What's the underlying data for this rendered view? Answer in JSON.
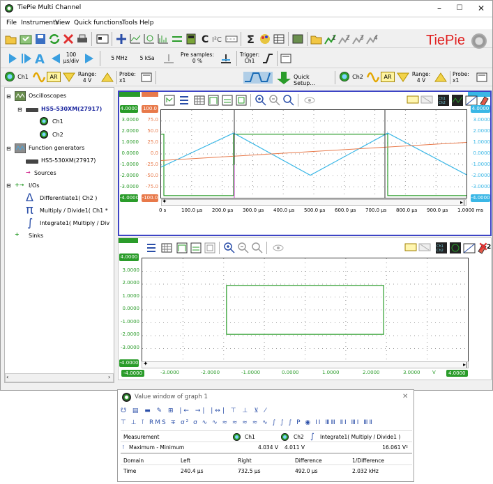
{
  "window": {
    "title": "TiePie Multi Channel",
    "min": "–",
    "max": "☐",
    "close": "✕"
  },
  "menu": [
    "File",
    "Instruments",
    "View",
    "Quick functions",
    "Tools",
    "Help"
  ],
  "brand": "TiePie",
  "toolbar2": {
    "timebase": "100",
    "timebase_unit": "µs/div",
    "samplerate": "5 MHz",
    "record_length": "5 kSa",
    "pre_samples_label": "Pre samples:",
    "pre_samples_value": "0 %",
    "trigger_label": "Trigger:",
    "trigger_value": "Ch1"
  },
  "toolbar3": {
    "ch1": "Ch1",
    "ch2": "Ch2",
    "coupling": "AR",
    "range_label": "Range:",
    "range_value": "4 V",
    "probe_label": "Probe:",
    "probe_value": "x1",
    "quick_setup": "Quick Setup..."
  },
  "tree": {
    "oscilloscopes": "Oscilloscopes",
    "device": "HS5-530XM(27917)",
    "ch1": "Ch1",
    "ch2": "Ch2",
    "function_generators": "Function generators",
    "gen_device": "HS5-530XM(27917)",
    "sources": "Sources",
    "ios": "I/Os",
    "differentiate": "Differentiate1( Ch2 )",
    "multiply": "Multiply / Divide1( Ch1 *",
    "integrate": "Integrate1( Multiply / Div",
    "sinks": "Sinks"
  },
  "graph1": {
    "number": "1",
    "y_left": [
      "3.0000",
      "2.0000",
      "1.0000",
      "0.0000",
      "-1.0000",
      "-2.0000",
      "-3.0000"
    ],
    "y_mid": [
      "75.0",
      "50.0",
      "25.0",
      "0.0",
      "-25.0",
      "-50.0",
      "-75.0"
    ],
    "y_top_left": "4.0000",
    "y_top_mid": "100.0",
    "y_bot_left": "-4.0000",
    "y_bot_mid": "-100.0",
    "y_right": [
      "3.0000",
      "2.0000",
      "1.0000",
      "0.0000",
      "-1.0000",
      "-2.0000",
      "-3.0000"
    ],
    "y_top_right": "4.0000",
    "y_bot_right": "-4.0000",
    "x": [
      "0 s",
      "100.0 µs",
      "200.0 µs",
      "300.0 µs",
      "400.0 µs",
      "500.0 µs",
      "600.0 µs",
      "700.0 µs",
      "800.0 µs",
      "900.0 µs",
      "1.0000 ms"
    ]
  },
  "graph2": {
    "number": "2",
    "y": [
      "3.0000",
      "2.0000",
      "1.0000",
      "0.0000",
      "-1.0000",
      "-2.0000",
      "-3.0000"
    ],
    "y_top": "4.0000",
    "y_bot": "-4.0000",
    "x": [
      "-4.0000",
      "-3.0000",
      "-2.0000",
      "-1.0000",
      "0.0000",
      "1.0000",
      "2.0000",
      "3.0000",
      "V",
      "4.0000"
    ]
  },
  "value_window": {
    "title": "Value window of graph 1",
    "close": "✕",
    "headers": [
      "Measurement",
      "Ch1",
      "Ch2",
      "Integrate1( Multiply / Divide1 )"
    ],
    "row_label": "Maximum - Minimum",
    "row_values": [
      "4.034 V",
      "4.011 V",
      "16.061 V²"
    ],
    "cursor_headers": [
      "Domain",
      "Left",
      "Right",
      "Difference",
      "1/Difference"
    ],
    "cursor_values": [
      "Time",
      "240.4 µs",
      "732.5 µs",
      "492.0 µs",
      "2.032 kHz"
    ]
  },
  "colors": {
    "ch1": "#2a9c2a",
    "ch2": "#3ab7e6",
    "math": "#e8794a",
    "graph_border": "#3d44c5",
    "brand": "#e02020"
  }
}
